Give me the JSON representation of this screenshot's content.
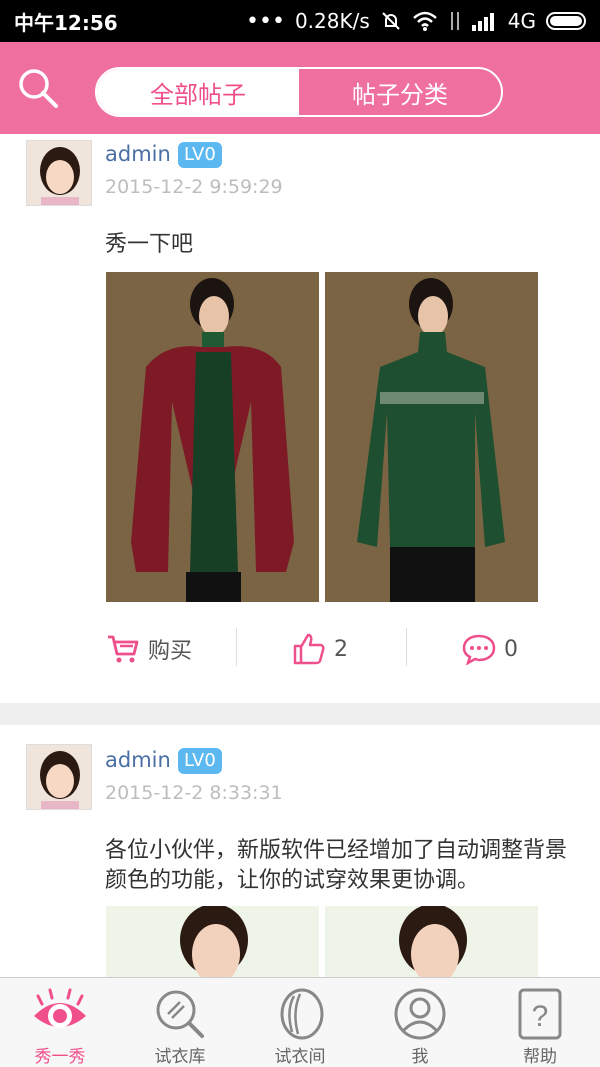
{
  "status": {
    "time": "中午12:56",
    "speed": "0.28K/s",
    "network": "4G"
  },
  "header": {
    "tabs": [
      "全部帖子",
      "帖子分类"
    ]
  },
  "posts": [
    {
      "user": "admin",
      "level": "LV0",
      "time": "2015-12-2 9:59:29",
      "text": "秀一下吧",
      "buy_label": "购买",
      "likes": "2",
      "comments": "0"
    },
    {
      "user": "admin",
      "level": "LV0",
      "time": "2015-12-2 8:33:31",
      "text": "各位小伙伴，新版软件已经增加了自动调整背景颜色的功能，让你的试穿效果更协调。"
    }
  ],
  "tabbar": {
    "items": [
      "秀一秀",
      "试衣库",
      "试衣间",
      "我",
      "帮助"
    ]
  },
  "colors": {
    "accent": "#ef6f9f",
    "accent_text": "#ef4f8a",
    "level_badge": "#5cb8f0",
    "username": "#4a6fa5"
  }
}
